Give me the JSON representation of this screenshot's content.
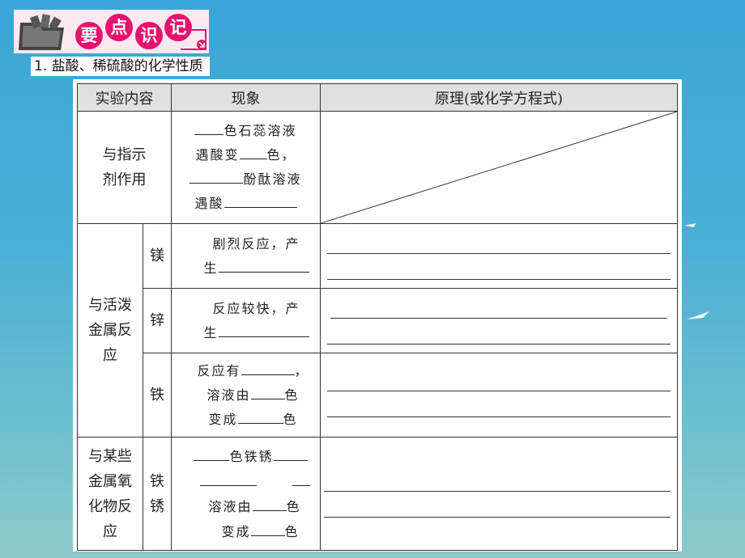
{
  "badge": {
    "chars": [
      "要",
      "点",
      "识",
      "记"
    ],
    "color": "#e9116e"
  },
  "subtitle": "1. 盐酸、稀硫酸的化学性质",
  "table": {
    "headers": [
      "实验内容",
      "现象",
      "原理(或化学方程式)"
    ],
    "indicator": {
      "label_lines": [
        "与指示",
        "剂作用"
      ],
      "phen": [
        "色石蕊溶液",
        "遇酸变",
        "色，",
        "酚酞溶液",
        "遇酸"
      ]
    },
    "metal_group": {
      "label_lines": [
        "与活泼",
        "金属反",
        "应"
      ],
      "magnesium": {
        "metal": "镁",
        "line1": "剧烈反应，产",
        "line2": "生"
      },
      "zinc": {
        "metal": "锌",
        "line1": "反应较快，产",
        "line2": "生"
      },
      "iron": {
        "metal": "铁",
        "line1": "反应有",
        "line1_end": "，",
        "line2": "溶液由",
        "line2_end": "色",
        "line3": "变成",
        "line3_end": "色"
      }
    },
    "oxide_group": {
      "label_lines": [
        "与某些",
        "金属氧",
        "化物反",
        "应"
      ],
      "rust_lines": [
        "铁",
        "锈"
      ],
      "line1": "色铁锈",
      "line3": "溶液由",
      "line3_end": "色",
      "line4": "变成",
      "line4_end": "色"
    }
  }
}
